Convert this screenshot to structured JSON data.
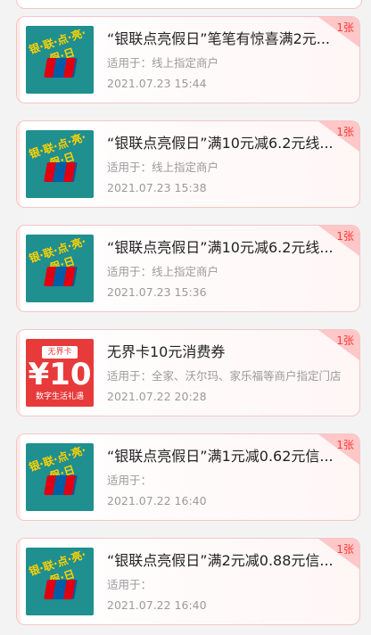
{
  "coupons": [
    {
      "thumb_slogan": "银·联·点·亮·假·日",
      "badge": "1张",
      "title": "“银联点亮假日”笔笔有惊喜满2元...",
      "scope": "适用于：线上指定商户",
      "date": "2021.07.23 15:44"
    },
    {
      "thumb_slogan": "银·联·点·亮·假·日",
      "badge": "1张",
      "title": "“银联点亮假日”满10元减6.2元线...",
      "scope": "适用于：线上指定商户",
      "date": "2021.07.23 15:38"
    },
    {
      "thumb_slogan": "银·联·点·亮·假·日",
      "badge": "1张",
      "title": "“银联点亮假日”满10元减6.2元线...",
      "scope": "适用于：线上指定商户",
      "date": "2021.07.23 15:36"
    },
    {
      "thumb_tag": "无界卡",
      "thumb_big": "¥10",
      "thumb_sub": "数字生活礼遇",
      "badge": "1张",
      "title": "无界卡10元消费券",
      "scope": "适用于：全家、沃尔玛、家乐福等商户指定门店",
      "date": "2021.07.22 20:28"
    },
    {
      "thumb_slogan": "银·联·点·亮·假·日",
      "badge": "1张",
      "title": "“银联点亮假日”满1元减0.62元信...",
      "scope": "适用于：",
      "date": "2021.07.22 16:40"
    },
    {
      "thumb_slogan": "银·联·点·亮·假·日",
      "badge": "1张",
      "title": "“银联点亮假日”满2元减0.88元信...",
      "scope": "适用于：",
      "date": "2021.07.22 16:40"
    }
  ],
  "colors": {
    "accent": "#ff3b3b",
    "badge_bg": "#ffc7c7",
    "thumb_teal": "#1f8f8f",
    "thumb_red": "#e73a3a"
  },
  "icons": {
    "unionpay_logo": "unionpay-logo-icon"
  }
}
